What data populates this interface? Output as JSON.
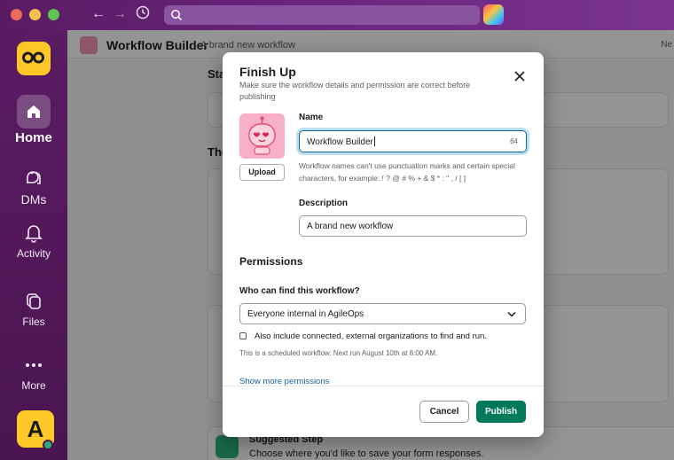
{
  "sidebar": {
    "items": [
      {
        "label": "Home",
        "icon": "home-icon"
      },
      {
        "label": "DMs",
        "icon": "dms-icon"
      },
      {
        "label": "Activity",
        "icon": "bell-icon"
      },
      {
        "label": "Files",
        "icon": "files-icon"
      },
      {
        "label": "More",
        "icon": "more-icon"
      }
    ],
    "user_initial": "A"
  },
  "main": {
    "title": "Workflow Builder",
    "subtitle": "A brand new workflow",
    "right_label": "Ne",
    "bg_labels": [
      "Sta",
      "The"
    ],
    "suggested": {
      "title": "Suggested Step",
      "desc": "Choose where you'd like to save your form responses."
    }
  },
  "modal": {
    "title": "Finish Up",
    "subtitle": "Make sure the workflow details and permission are correct before publishing",
    "upload_label": "Upload",
    "name_label": "Name",
    "name_value": "Workflow Builder",
    "name_count": "64",
    "name_hint": "Workflow names can't use punctuation marks and certain special characters, for example: ! ? @ # % + & $ * : \" , / [ ]",
    "description_label": "Description",
    "description_value": "A brand new workflow",
    "permissions_heading": "Permissions",
    "who_can_find_label": "Who can find this workflow?",
    "who_can_find_value": "Everyone internal in AgileOps",
    "external_checkbox_label": "Also include connected, external organizations to find and run.",
    "external_checked": false,
    "schedule_note": "This is a scheduled workflow. Next run August 10th at 8:00 AM.",
    "show_more_link": "Show more permissions",
    "cancel_label": "Cancel",
    "publish_label": "Publish"
  },
  "colors": {
    "sidebar": "#4a1550",
    "accent_green": "#007a5a",
    "link_blue": "#1264a3",
    "workspace_yellow": "#ffc829"
  }
}
